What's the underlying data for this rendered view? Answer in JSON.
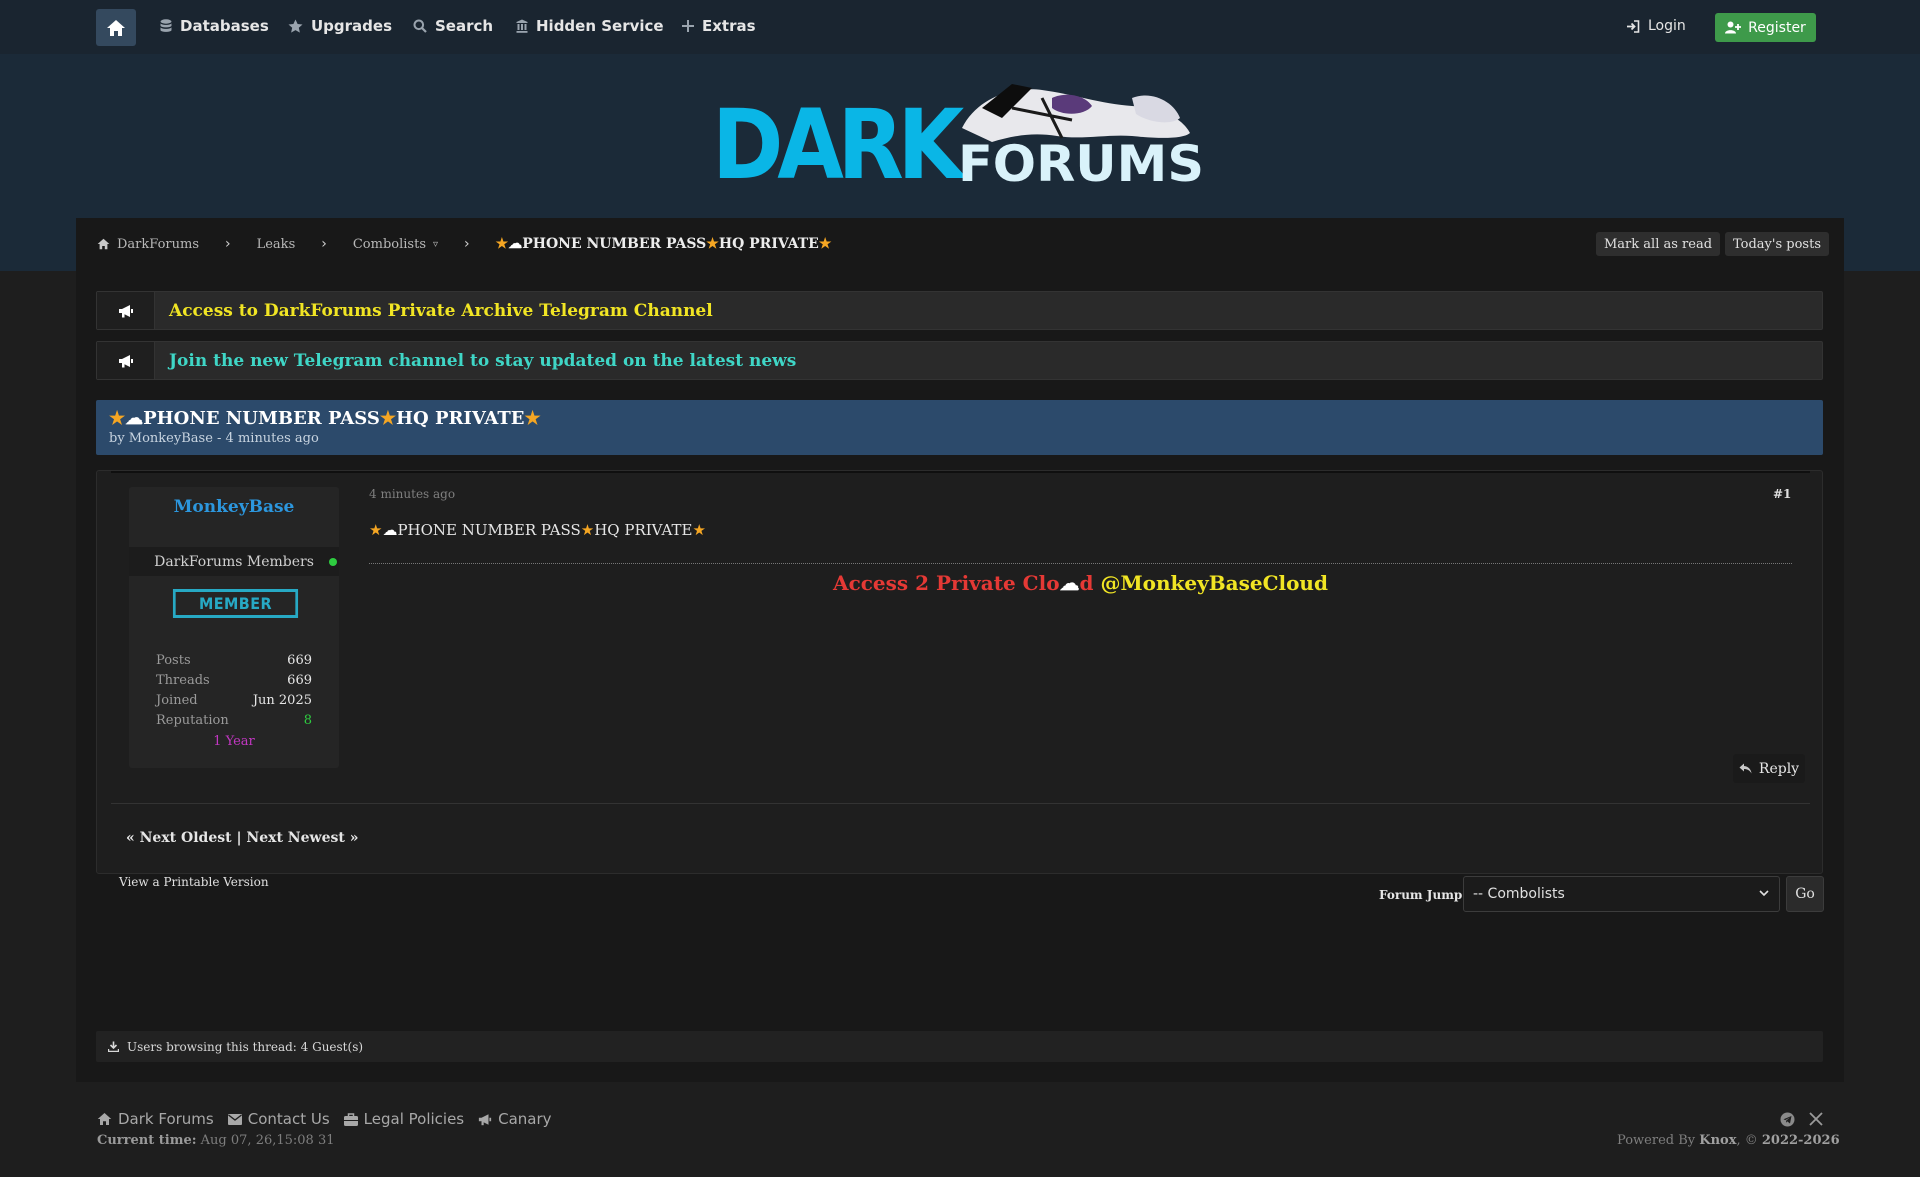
{
  "nav": {
    "items": [
      "Databases",
      "Upgrades",
      "Search",
      "Hidden Service",
      "Extras"
    ],
    "login": "Login",
    "register": "Register"
  },
  "logo": {
    "text_dark": "DARK",
    "text_forums": "FORUMS"
  },
  "breadcrumb": {
    "items": [
      "DarkForums",
      "Leaks",
      "Combolists"
    ],
    "dropdown_marker": "▿",
    "current_title": "PHONE NUMBER PASS",
    "current_title_end": "HQ PRIVATE",
    "mark_all_read": "Mark all as read",
    "todays_posts": "Today's posts"
  },
  "announcements": [
    {
      "text": "Access to DarkForums Private Archive Telegram Channel",
      "color": "#f1e524"
    },
    {
      "text": "Join the new Telegram channel to stay updated on the latest news",
      "color": "#3fd6c6"
    }
  ],
  "thread": {
    "title_a": "PHONE NUMBER PASS",
    "title_b": "HQ PRIVATE",
    "byline": "by MonkeyBase - 4 minutes ago"
  },
  "post": {
    "username": "MonkeyBase",
    "user_group": "DarkForums Members",
    "badge": "MEMBER",
    "stats": [
      {
        "label": "Posts",
        "value": "669"
      },
      {
        "label": "Threads",
        "value": "669"
      },
      {
        "label": "Joined",
        "value": "Jun 2025"
      },
      {
        "label": "Reputation",
        "value": "8"
      }
    ],
    "year_badge": "1 Year",
    "date": "4 minutes ago",
    "number": "#1",
    "subject_a": "PHONE NUMBER PASS",
    "subject_b": "HQ PRIVATE",
    "message_part1": "Access 2 Private Clo",
    "message_cloud": "☁",
    "message_part2": "d",
    "message_handle": "@MonkeyBaseCloud",
    "reply": "Reply",
    "nav_text": "« Next Oldest | Next Newest »"
  },
  "printable": "View a Printable Version",
  "forum_jump": {
    "label": "Forum Jump:",
    "selected": "-- Combolists",
    "go": "Go"
  },
  "browsing": "Users browsing this thread: 4 Guest(s)",
  "footer": {
    "links": [
      "Dark Forums",
      "Contact Us",
      "Legal Policies",
      "Canary"
    ],
    "current_time_label": "Current time:",
    "current_time_value": "Aug 07, 26,15:08 31",
    "powered_prefix": "Powered By",
    "powered_brand": "Knox",
    "powered_suffix": ", ©",
    "powered_years": "2022-2026"
  },
  "colors": {
    "accent_blue": "#2c97de",
    "register_green": "#3e9a4a",
    "thread_head": "#2c4a6b",
    "message_red": "#e53935",
    "message_yellow": "#f1e524"
  },
  "icons": [
    "home-icon",
    "database-icon",
    "star-icon",
    "search-icon",
    "building-icon",
    "plus-icon",
    "login-icon",
    "user-plus-icon",
    "megaphone-icon",
    "reply-icon",
    "download-icon",
    "briefcase-icon",
    "envelope-icon",
    "telegram-icon",
    "x-icon"
  ]
}
